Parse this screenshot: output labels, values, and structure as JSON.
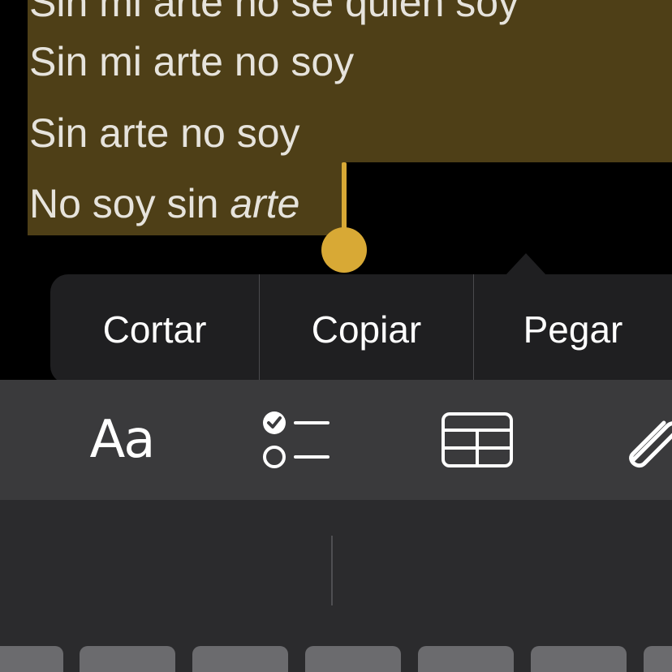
{
  "note": {
    "lines": {
      "0": "Sin mi arte no sé quién soy",
      "1": "Sin mi arte no soy",
      "2": "Sin arte no soy",
      "3_plain": "No soy sin ",
      "3_italic": "arte"
    }
  },
  "edit_menu": {
    "cut": "Cortar",
    "copy": "Copiar",
    "paste": "Pegar"
  },
  "toolbar": {
    "format_label": "Aa",
    "icons": [
      "format-icon",
      "checklist-icon",
      "table-icon",
      "paperclip-icon"
    ]
  },
  "colors": {
    "selection": "#4e3f17",
    "handle": "#d8a935",
    "text": "#e6e3dc",
    "menu_bg": "#1f1f21",
    "toolbar_bg": "#3a3a3c",
    "keyboard_bg": "#2b2b2d"
  }
}
